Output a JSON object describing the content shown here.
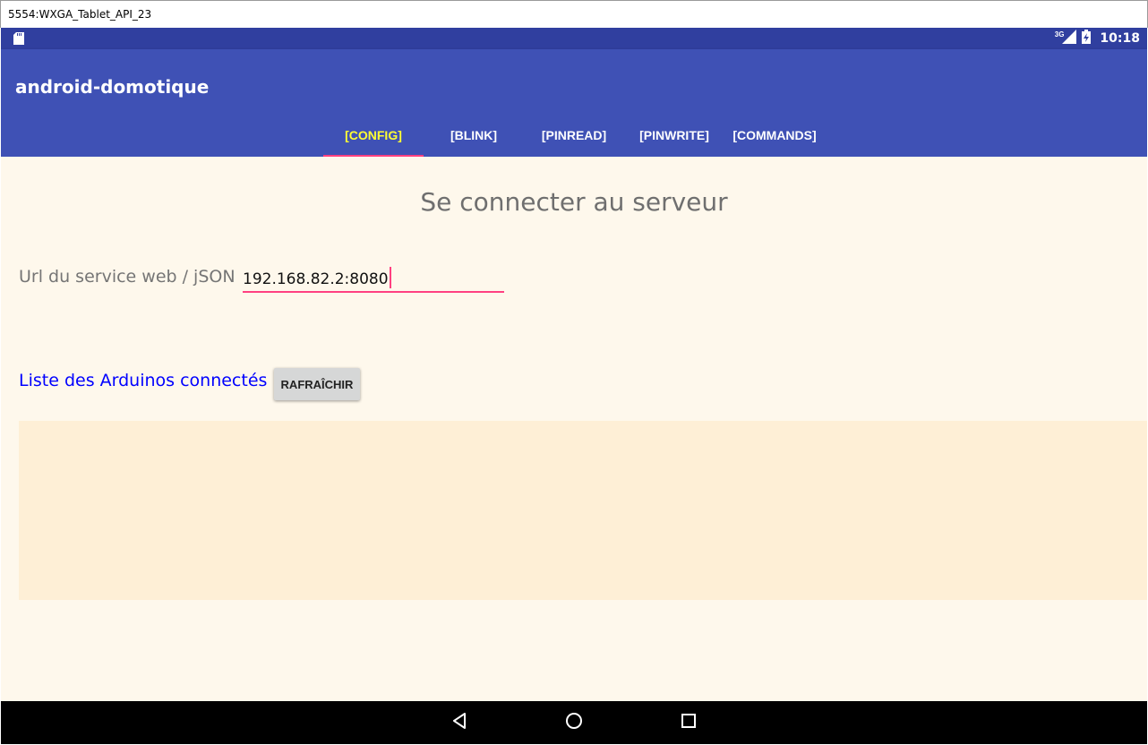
{
  "window": {
    "title": "5554:WXGA_Tablet_API_23"
  },
  "statusbar": {
    "network_label": "3G",
    "time": "10:18"
  },
  "appbar": {
    "title": "android-domotique",
    "tabs": [
      {
        "label": "[CONFIG]",
        "active": true
      },
      {
        "label": "[BLINK]"
      },
      {
        "label": "[PINREAD]"
      },
      {
        "label": "[PINWRITE]"
      },
      {
        "label": "[COMMANDS]"
      }
    ]
  },
  "config": {
    "heading": "Se connecter au serveur",
    "url_label": "Url du service web / jSON",
    "url_value": "192.168.82.2:8080",
    "arduinos_label": "Liste des Arduinos connectés",
    "refresh_button": "RAFRAÎCHIR"
  },
  "icons": {
    "sd_card": "sd-card-icon",
    "signal": "signal-icon",
    "battery": "battery-charging-icon",
    "back": "back-triangle-icon",
    "home": "home-circle-icon",
    "recents": "recents-square-icon"
  },
  "colors": {
    "statusbar": "#303f9f",
    "appbar": "#3f51b5",
    "accent": "#ff4081",
    "active_tab_text": "#ffff33",
    "content_bg": "#fef8ec",
    "list_bg": "#feefd6",
    "arduinos_label": "#0000ff"
  }
}
